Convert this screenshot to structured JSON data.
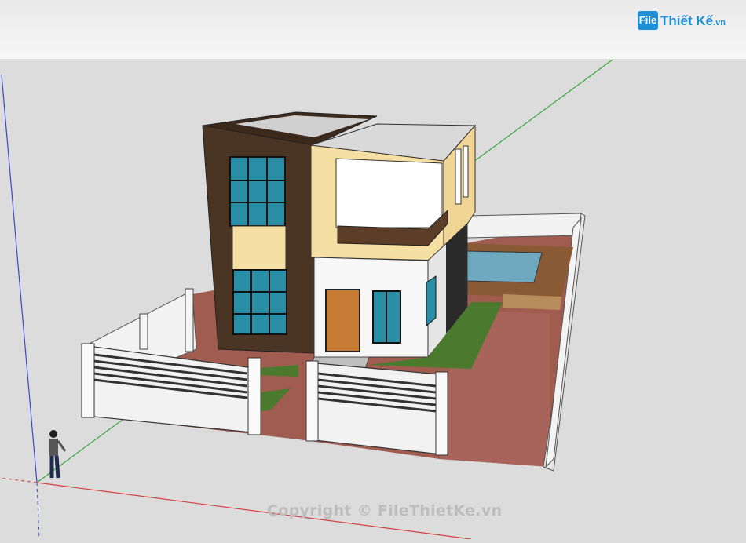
{
  "logo": {
    "box_text": "File",
    "main_text": "Thiết Kế",
    "domain_text": ".vn"
  },
  "watermark": "Copyright © FileThietKe.vn",
  "colors": {
    "sky_top": "#e8e8e8",
    "ground": "#dcdcdc",
    "axis_red": "#d14040",
    "axis_green": "#3aa83a",
    "axis_blue": "#3b46c8",
    "dark_brown": "#4a3424",
    "cream": "#f6dfa3",
    "glass": "#2a8fa6",
    "door": "#c57b34",
    "paving": "#a15c50",
    "grass": "#4b7a2f",
    "wall": "#f2f2f2",
    "pool": "#6fa9bf",
    "deck": "#8a5a35"
  }
}
